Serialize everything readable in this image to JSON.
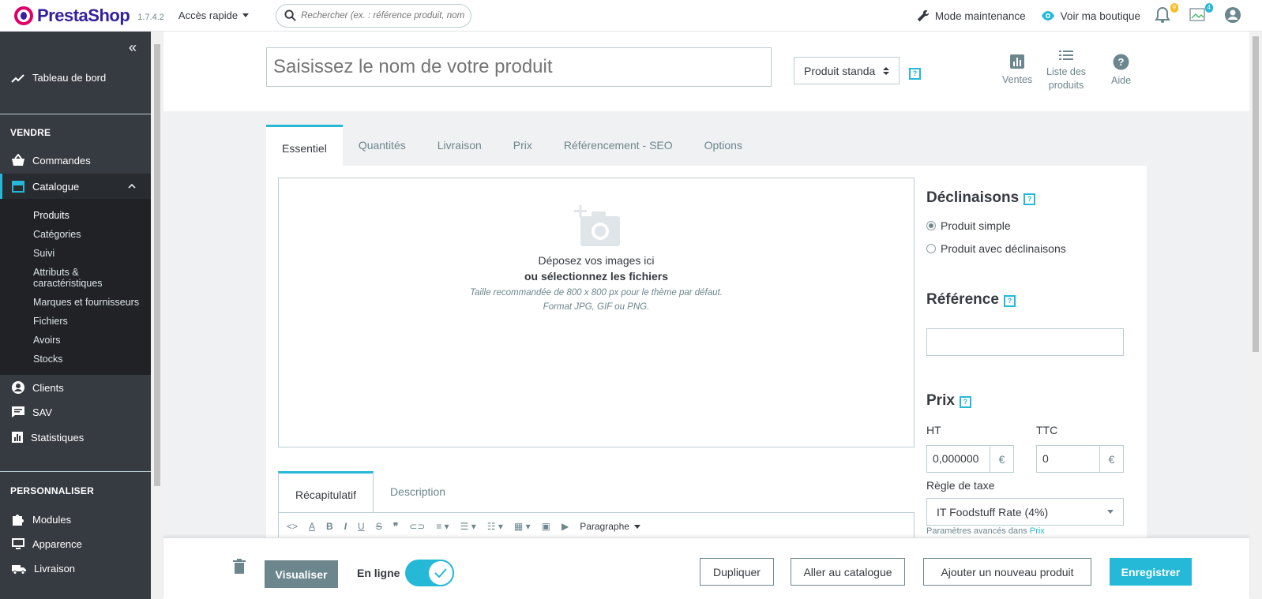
{
  "topbar": {
    "logo_text": "PrestaShop",
    "version": "1.7.4.2",
    "quick_access": "Accès rapide",
    "search_placeholder": "Rechercher (ex. : référence produit, nom",
    "maintenance": "Mode maintenance",
    "view_shop": "Voir ma boutique",
    "notif_count": "9",
    "msg_count": "4"
  },
  "sidebar": {
    "dashboard": "Tableau de bord",
    "section_sell": "VENDRE",
    "orders": "Commandes",
    "catalog": "Catalogue",
    "catalog_sub": [
      "Produits",
      "Catégories",
      "Suivi",
      "Attributs & caractéristiques",
      "Marques et fournisseurs",
      "Fichiers",
      "Avoirs",
      "Stocks"
    ],
    "customers": "Clients",
    "sav": "SAV",
    "stats": "Statistiques",
    "section_custom": "PERSONNALISER",
    "modules": "Modules",
    "appearance": "Apparence",
    "shipping": "Livraison"
  },
  "header": {
    "name_placeholder": "Saisissez le nom de votre produit",
    "type_value": "Produit standa",
    "help": "?",
    "sales": "Ventes",
    "product_list_1": "Liste des",
    "product_list_2": "produits",
    "help_label": "Aide"
  },
  "tabs": [
    "Essentiel",
    "Quantités",
    "Livraison",
    "Prix",
    "Référencement - SEO",
    "Options"
  ],
  "dropzone": {
    "line1": "Déposez vos images ici",
    "line2": "ou sélectionnez les fichiers",
    "line3": "Taille recommandée de 800 x 800 px pour le thème par défaut.",
    "line4": "Format JPG, GIF ou PNG."
  },
  "subtabs": [
    "Récapitulatif",
    "Description"
  ],
  "editor": {
    "paragraph": "Paragraphe"
  },
  "right": {
    "variations_title": "Déclinaisons",
    "simple": "Produit simple",
    "with_variations": "Produit avec déclinaisons",
    "reference_title": "Référence",
    "price_title": "Prix",
    "ht": "HT",
    "ttc": "TTC",
    "ht_value": "0,000000",
    "ttc_value": "0",
    "currency": "€",
    "tax_rule_label": "Règle de taxe",
    "tax_rule_value": "IT Foodstuff Rate (4%)",
    "advanced": "Paramètres avancés dans",
    "advanced_link": "Prix"
  },
  "footer": {
    "preview": "Visualiser",
    "online": "En ligne",
    "duplicate": "Dupliquer",
    "goto_catalog": "Aller au catalogue",
    "add_new": "Ajouter un nouveau produit",
    "save": "Enregistrer"
  }
}
